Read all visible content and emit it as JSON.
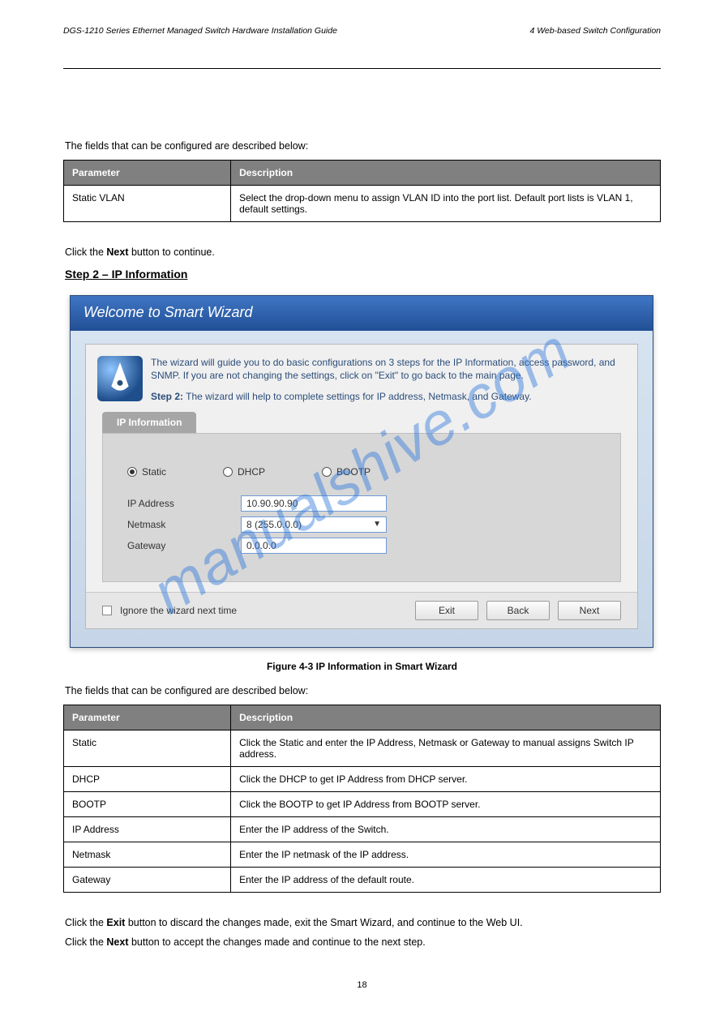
{
  "header": {
    "doc_title": "DGS-1210 Series Ethernet Managed Switch Hardware Installation Guide",
    "section": "4 Web-based Switch Configuration"
  },
  "intro1": "The fields that can be configured are described below:",
  "table1": {
    "head_param": "Parameter",
    "head_desc": "Description",
    "row_param": "Static VLAN",
    "row_desc": "Select the drop-down menu to assign VLAN ID into the port list. Default port lists is VLAN 1, default settings."
  },
  "after1": "Click the Next button to continue.",
  "section_title": "Step 2 – IP Information",
  "wizard": {
    "title": "Welcome to Smart Wizard",
    "desc": "The wizard will guide you to do basic configurations on 3 steps for the IP Information, access password, and SNMP. If you are not changing the settings, click on \"Exit\" to go back to the main page.",
    "step_bold": "Step 2:",
    "step_text": " The wizard will help to complete settings for IP address, Netmask, and Gateway.",
    "tab": "IP Information",
    "radio_static": "Static",
    "radio_dhcp": "DHCP",
    "radio_bootp": "BOOTP",
    "label_ip": "IP Address",
    "label_netmask": "Netmask",
    "label_gateway": "Gateway",
    "val_ip": "10.90.90.90",
    "val_netmask": "8 (255.0.0.0)",
    "val_gateway": "0.0.0.0",
    "ignore": "Ignore the wizard next time",
    "btn_exit": "Exit",
    "btn_back": "Back",
    "btn_next": "Next"
  },
  "watermark": "manualshive.com",
  "caption_fig": "Figure 4-3 IP Information in Smart Wizard",
  "intro2": "The fields that can be configured are described below:",
  "table2": {
    "head_param": "Parameter",
    "head_desc": "Description",
    "rows": [
      {
        "p": "Static",
        "d": "Click the Static and enter the IP Address, Netmask or Gateway to manual assigns Switch IP address."
      },
      {
        "p": "DHCP",
        "d": "Click the DHCP to get IP Address from DHCP server."
      },
      {
        "p": "BOOTP",
        "d": "Click the BOOTP to get IP Address from BOOTP server."
      },
      {
        "p": "IP Address",
        "d": "Enter the IP address of the Switch."
      },
      {
        "p": "Netmask",
        "d": "Enter the IP netmask of the IP address."
      },
      {
        "p": "Gateway",
        "d": "Enter the IP address of the default route."
      }
    ]
  },
  "after2_line1": "Click the Exit button to discard the changes made, exit the Smart Wizard, and continue to the Web UI.",
  "after2_line2": "Click the Next button to accept the changes made and continue to the next step.",
  "page_num": "18"
}
